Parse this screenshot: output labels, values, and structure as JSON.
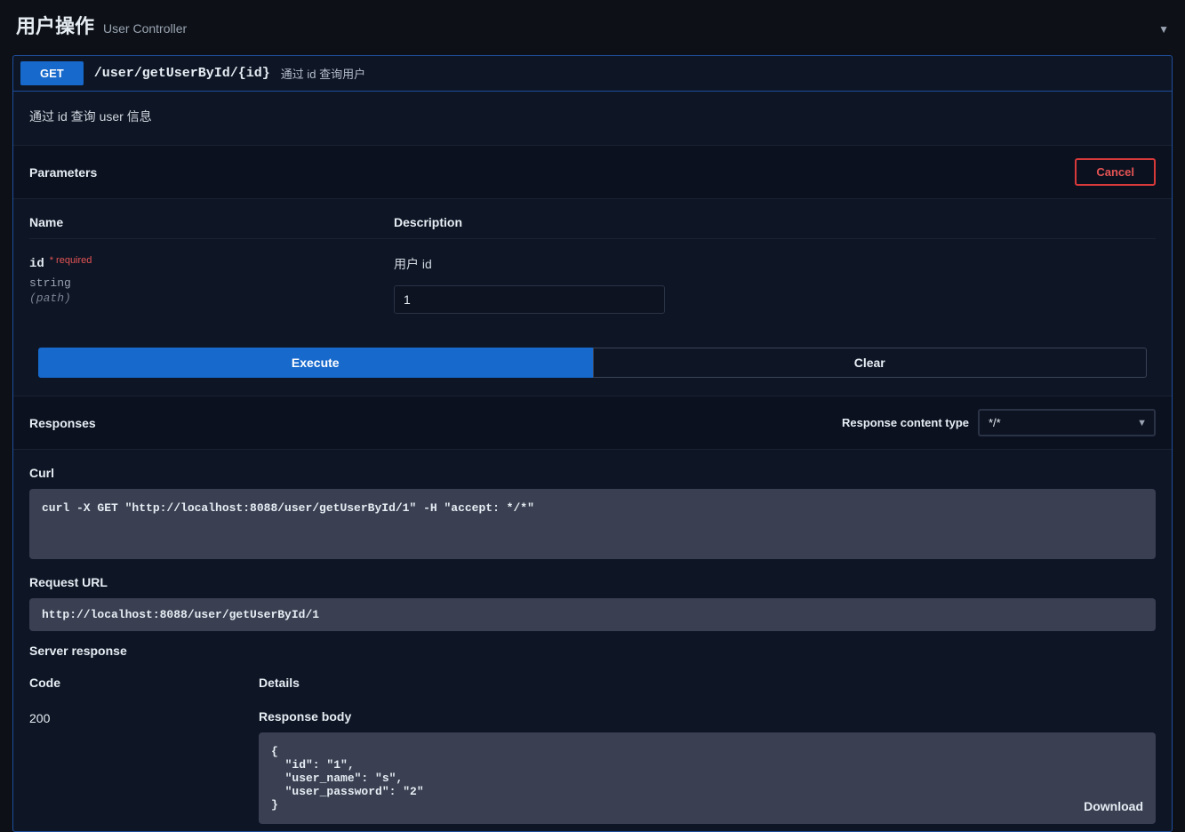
{
  "tag": {
    "title": "用户操作",
    "subtitle": "User Controller"
  },
  "operation": {
    "method": "GET",
    "path": "/user/getUserById/{id}",
    "shortDesc": "通过 id 查询用户",
    "description": "通过 id 查询 user 信息"
  },
  "parameters": {
    "sectionTitle": "Parameters",
    "cancelLabel": "Cancel",
    "columns": {
      "name": "Name",
      "description": "Description"
    },
    "items": [
      {
        "name": "id",
        "requiredLabel": "* required",
        "type": "string",
        "in": "(path)",
        "description": "用户 id",
        "value": "1"
      }
    ],
    "executeLabel": "Execute",
    "clearLabel": "Clear"
  },
  "responses": {
    "sectionTitle": "Responses",
    "contentTypeLabel": "Response content type",
    "contentTypeValue": "*/*",
    "curlTitle": "Curl",
    "curlCommand": "curl -X GET \"http://localhost:8088/user/getUserById/1\" -H \"accept: */*\"",
    "requestUrlTitle": "Request URL",
    "requestUrl": "http://localhost:8088/user/getUserById/1",
    "serverResponseTitle": "Server response",
    "columns": {
      "code": "Code",
      "details": "Details"
    },
    "status": "200",
    "responseBodyTitle": "Response body",
    "responseBody": "{\n  \"id\": \"1\",\n  \"user_name\": \"s\",\n  \"user_password\": \"2\"\n}",
    "downloadLabel": "Download"
  }
}
